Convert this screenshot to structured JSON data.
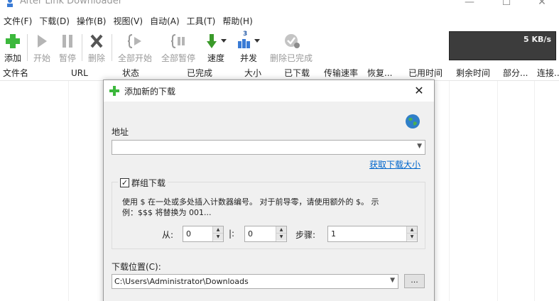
{
  "window": {
    "title": "After Link Downloader",
    "minimize": "—",
    "maximize": "☐",
    "close": "✕"
  },
  "menu": [
    "文件(F)",
    "下载(D)",
    "操作(B)",
    "视图(V)",
    "自动(A)",
    "工具(T)",
    "帮助(H)"
  ],
  "toolbar": {
    "add": "添加",
    "start": "开始",
    "pause": "暂停",
    "delete": "删除",
    "start_all": "全部开始",
    "pause_all": "全部暂停",
    "speed": "速度",
    "concurrency": "并发",
    "delete_completed": "删除已完成",
    "concurrency_badge": "3"
  },
  "speed_graph": {
    "value": "5 KB/s"
  },
  "columns": [
    "文件名",
    "URL",
    "状态",
    "已完成",
    "大小",
    "已下载",
    "传输速率",
    "恢复...",
    "已用时间",
    "剩余时间",
    "部分...",
    "连接..."
  ],
  "dialog": {
    "title": "添加新的下载",
    "close": "✕",
    "address_label": "地址",
    "address_value": "",
    "get_size_link": "获取下载大小",
    "group_download_checked": true,
    "check_mark": "✓",
    "group_download_label": "群组下载",
    "hint_line1": "使用 $ 在一处或多处插入计数器编号。 对于前导零，请使用额外的 $。 示",
    "hint_line2": "例：$$$ 将替换为 001...",
    "from_label": "从:",
    "from_value": "0",
    "to_label": "|:",
    "to_value": "0",
    "step_label": "步骤:",
    "step_value": "1",
    "location_label": "下载位置(C):",
    "location_value": "C:\\Users\\Administrator\\Downloads",
    "browse_label": "..."
  },
  "colors": {
    "speed_graph_bg": "#3c3c3c",
    "link": "#0066cc",
    "add_icon": "#3cb83c",
    "speed_icon": "#3a9a2a"
  }
}
